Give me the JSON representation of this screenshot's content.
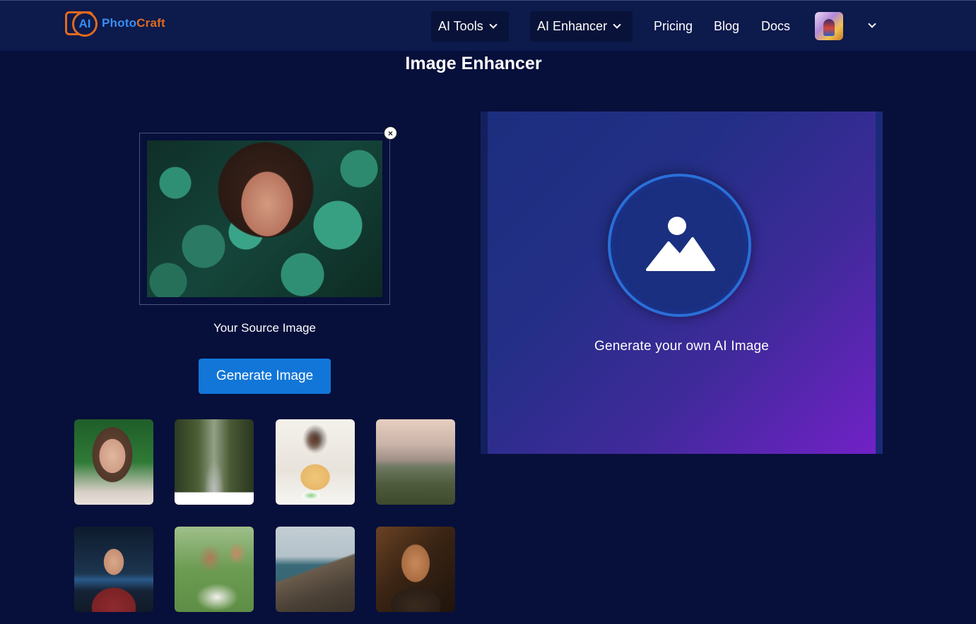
{
  "header": {
    "logo": {
      "ai": "AI",
      "photo": "Photo",
      "craft": "Craft"
    },
    "nav": {
      "ai_tools": "AI Tools",
      "ai_enhancer": "AI Enhancer",
      "pricing": "Pricing",
      "blog": "Blog",
      "docs": "Docs"
    }
  },
  "page": {
    "title": "Image Enhancer"
  },
  "source": {
    "close_glyph": "×",
    "caption": "Your Source Image",
    "generate_label": "Generate Image"
  },
  "output": {
    "caption": "Generate your own AI Image"
  },
  "icons": {
    "close": "close-icon",
    "chevron": "chevron-down-icon",
    "placeholder": "image-placeholder-icon"
  },
  "colors": {
    "background": "#070f3b",
    "header": "#0c1a4c",
    "primary_button": "#1176d8",
    "logo_blue": "#3a8ef0",
    "logo_orange": "#e06a1e",
    "panel_gradient_start": "#1c2e7e",
    "panel_gradient_end": "#7321c8"
  }
}
